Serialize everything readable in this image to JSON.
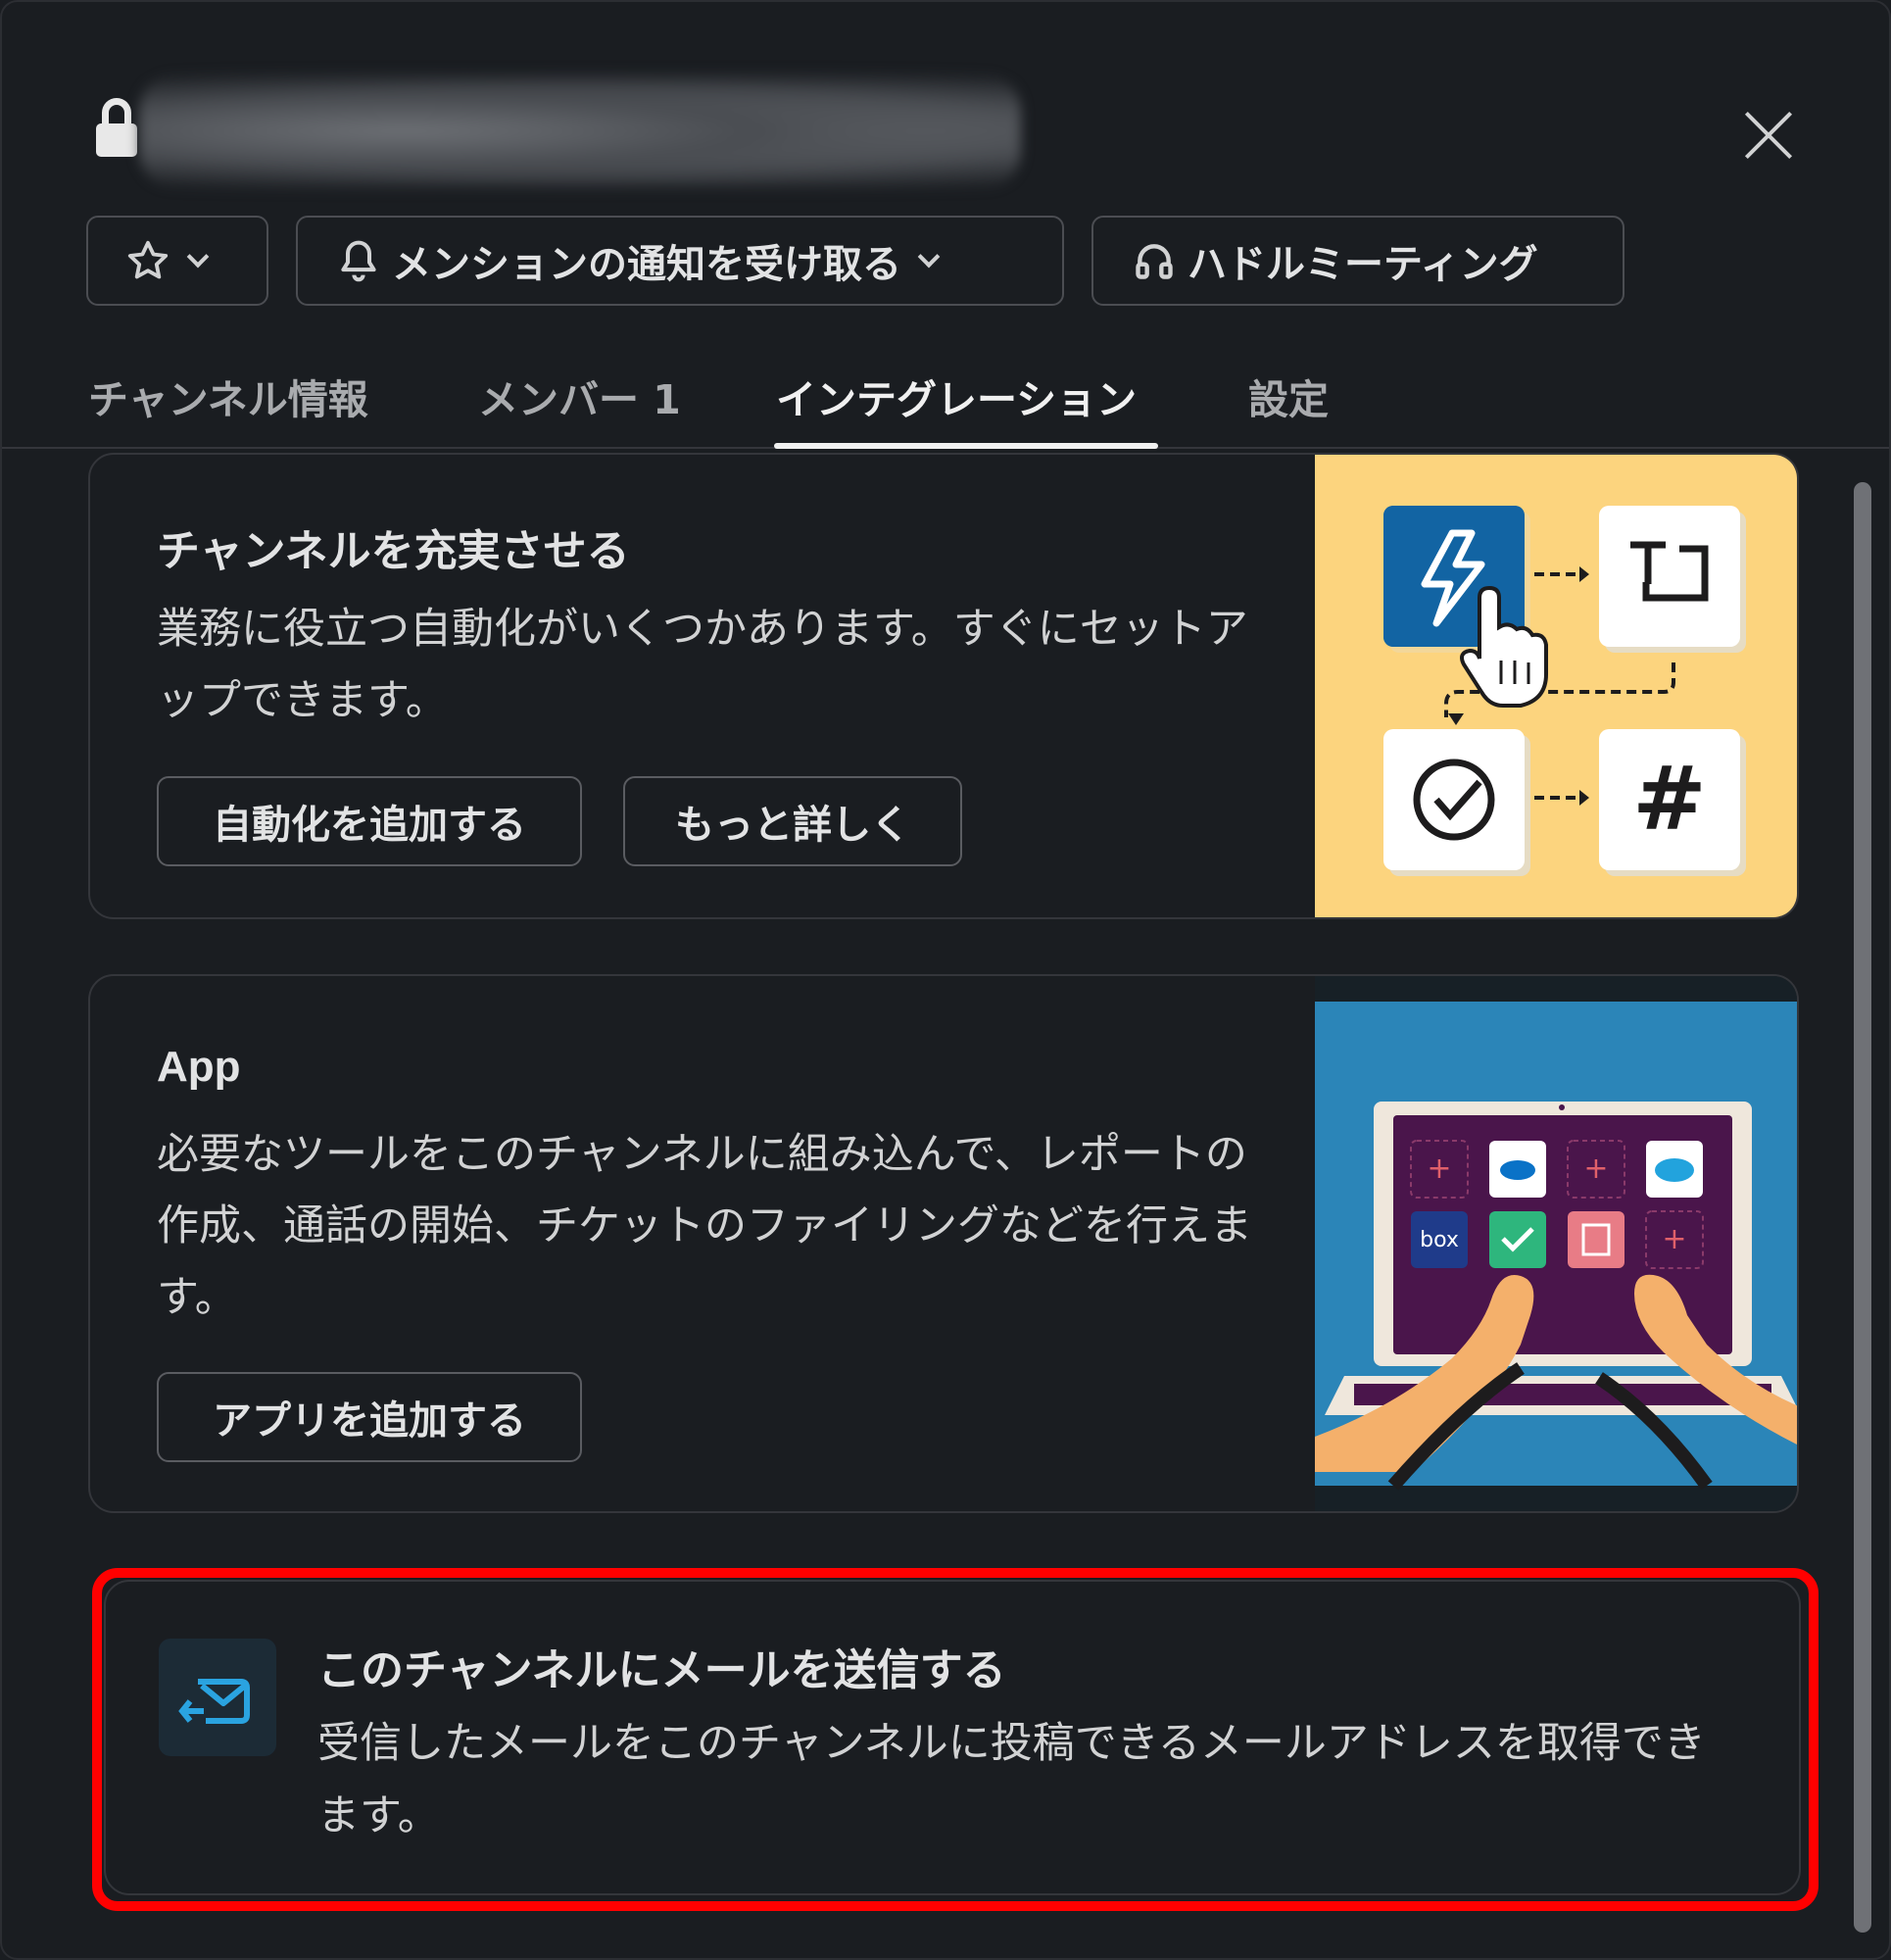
{
  "header": {
    "close_label": "×"
  },
  "actions": {
    "star_icon": "star-outline",
    "notify_label": "メンションの通知を受け取る",
    "huddle_label": "ハドルミーティング"
  },
  "tabs": [
    {
      "label": "チャンネル情報",
      "active": false
    },
    {
      "label": "メンバー 1",
      "active": false
    },
    {
      "label": "インテグレーション",
      "active": true
    },
    {
      "label": "設定",
      "active": false
    }
  ],
  "workflow_card": {
    "title": "チャンネルを充実させる",
    "description": "業務に役立つ自動化がいくつかあります。すぐにセットアップできます。",
    "add_button": "自動化を追加する",
    "learn_button": "もっと詳しく"
  },
  "app_card": {
    "title": "App",
    "description": "必要なツールをこのチャンネルに組み込んで、レポートの作成、通話の開始、チケットのファイリングなどを行えます。",
    "add_button": "アプリを追加する"
  },
  "email_card": {
    "title": "このチャンネルにメールを送信する",
    "description": "受信したメールをこのチャンネルに投稿できるメールアドレスを取得できます。"
  },
  "colors": {
    "background": "#1a1d21",
    "highlight": "#ff0000",
    "art_yellow": "#fcd47e",
    "art_blue": "#2b85b8"
  }
}
